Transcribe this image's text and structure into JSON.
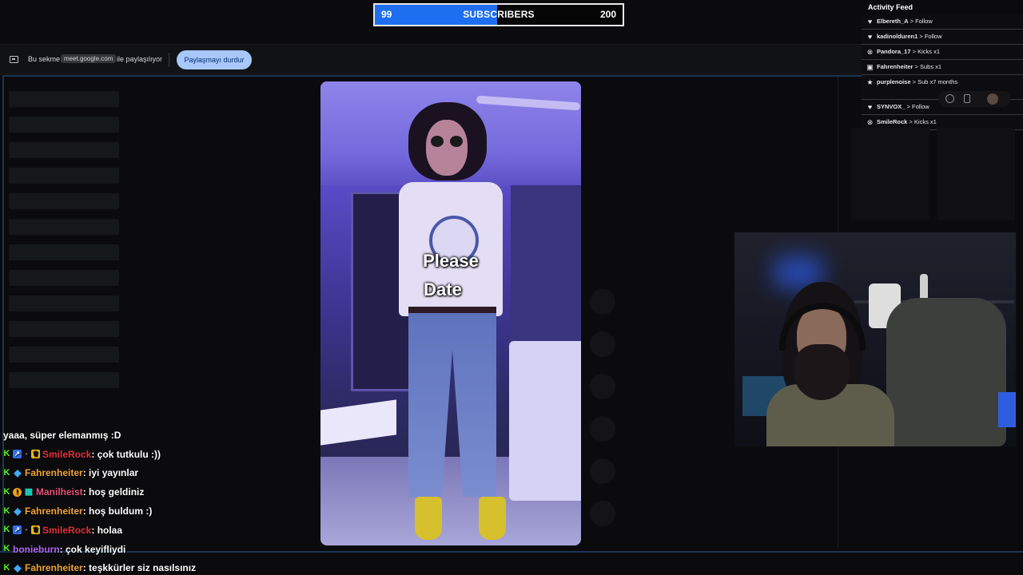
{
  "subscriber_goal": {
    "current": "99",
    "label": "SUBSCRIBERS",
    "goal": "200",
    "progress_fraction": 0.495,
    "fill_color": "#1e6ff0"
  },
  "share_bar": {
    "icon": "screen-share-icon",
    "prefix": "Bu sekme",
    "domain": "meet.google.com",
    "suffix": "ile paylaşılıyor",
    "stop_button": "Paylaşmayı durdur"
  },
  "video": {
    "caption_line1": "Please",
    "caption_line2": "Date"
  },
  "activity_feed": {
    "title": "Activity Feed",
    "items": [
      {
        "icon": "heart-icon",
        "user": "Elbereth_A",
        "action": "> Follow"
      },
      {
        "icon": "heart-icon",
        "user": "kadinolduren1",
        "action": "> Follow"
      },
      {
        "icon": "kick-icon",
        "user": "Pandora_17",
        "action": "> Kicks x1"
      },
      {
        "icon": "gift-icon",
        "user": "Fahrenheiter",
        "action": "> Subs x1"
      },
      {
        "icon": "star-icon",
        "user": "purplenoise",
        "action": "> Sub x7 months"
      },
      {
        "icon": "heart-icon",
        "user": "SYNVOX_",
        "action": "> Follow"
      },
      {
        "icon": "kick-icon",
        "user": "SmileRock",
        "action": "> Kicks x1"
      }
    ]
  },
  "chat": {
    "messages": [
      {
        "user": "",
        "user_color": "#ffffff",
        "text": "yaaa, süper elemanmış :D",
        "badges": []
      },
      {
        "user": "SmileRock",
        "user_color": "#e0323d",
        "text": " : çok tutkulu :))",
        "badges": [
          "kick",
          "sub",
          "small",
          "gift"
        ]
      },
      {
        "user": "Fahrenheiter",
        "user_color": "#f0a53a",
        "text": " : iyi yayınlar",
        "badges": [
          "kick",
          "gem"
        ]
      },
      {
        "user": "Manilheist",
        "user_color": "#e8527a",
        "text": " : hoş geldiniz",
        "badges": [
          "kick",
          "warn",
          "grid"
        ]
      },
      {
        "user": "Fahrenheiter",
        "user_color": "#f0a53a",
        "text": " : hoş buldum :)",
        "badges": [
          "kick",
          "gem"
        ]
      },
      {
        "user": "SmileRock",
        "user_color": "#e0323d",
        "text": " : holaa",
        "badges": [
          "kick",
          "sub",
          "small",
          "gift"
        ]
      },
      {
        "user": "bonieburn",
        "user_color": "#b066f0",
        "text": " : çok keyifliydi",
        "badges": [
          "kick"
        ]
      },
      {
        "user": "Fahrenheiter",
        "user_color": "#f0a53a",
        "text": " : teşkkürler siz nasılsınız",
        "badges": [
          "kick",
          "gem"
        ]
      }
    ]
  }
}
